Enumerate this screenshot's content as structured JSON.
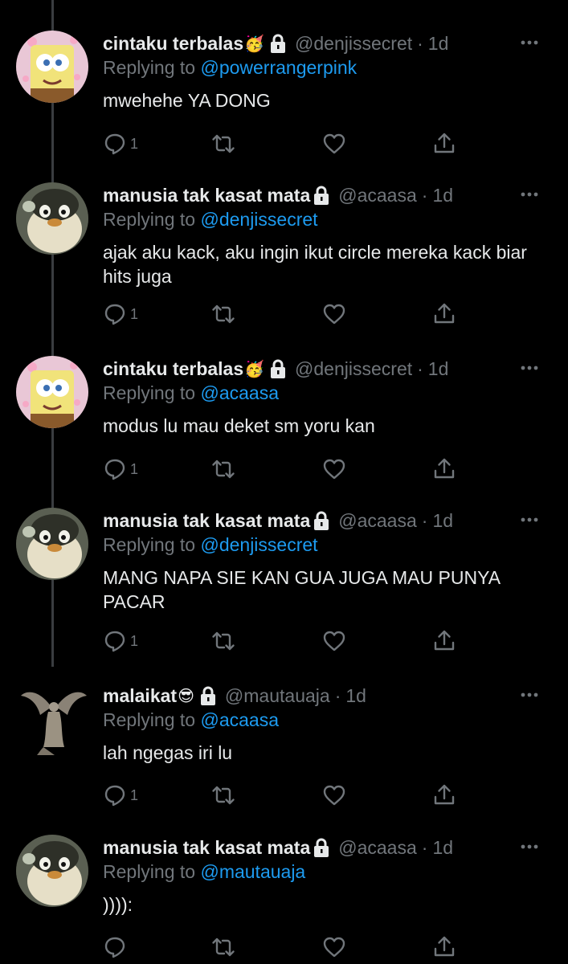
{
  "tweets": [
    {
      "name": "cintaku terbalas",
      "emoji": "🥳",
      "handle": "@denjissecret",
      "time": "1d",
      "replying_prefix": "Replying to ",
      "replying_to": "@powerrangerpink",
      "text": "mwehehe YA DONG",
      "reply_count": "1",
      "avatar": "spongebob-avatar"
    },
    {
      "name": "manusia tak kasat mata",
      "emoji": "",
      "handle": "@acaasa",
      "time": "1d",
      "replying_prefix": "Replying to ",
      "replying_to": "@denjissecret",
      "text": "ajak aku kack, aku ingin ikut circle mereka kack biar hits juga",
      "reply_count": "1",
      "avatar": "penguin-avatar"
    },
    {
      "name": "cintaku terbalas",
      "emoji": "🥳",
      "handle": "@denjissecret",
      "time": "1d",
      "replying_prefix": "Replying to ",
      "replying_to": "@acaasa",
      "text": "modus lu mau deket sm yoru kan",
      "reply_count": "1",
      "avatar": "spongebob-avatar"
    },
    {
      "name": "manusia tak kasat mata",
      "emoji": "",
      "handle": "@acaasa",
      "time": "1d",
      "replying_prefix": "Replying to ",
      "replying_to": "@denjissecret",
      "text": "MANG NAPA SIE KAN GUA JUGA MAU PUNYA PACAR",
      "reply_count": "1",
      "avatar": "penguin-avatar"
    },
    {
      "name": "malaikat",
      "emoji": "😎",
      "handle": "@mautauaja",
      "time": "1d",
      "replying_prefix": "Replying to ",
      "replying_to": "@acaasa",
      "text": "lah ngegas iri lu",
      "reply_count": "1",
      "avatar": "angel-statue-avatar"
    },
    {
      "name": "manusia tak kasat mata",
      "emoji": "",
      "handle": "@acaasa",
      "time": "1d",
      "replying_prefix": "Replying to ",
      "replying_to": "@mautauaja",
      "text": ")))):",
      "reply_count": "",
      "avatar": "penguin-avatar"
    }
  ],
  "separator": "·",
  "colors": {
    "background": "#000000",
    "primary_text": "#e7e9ea",
    "secondary_text": "#71767b",
    "mention": "#1d9bf0"
  }
}
